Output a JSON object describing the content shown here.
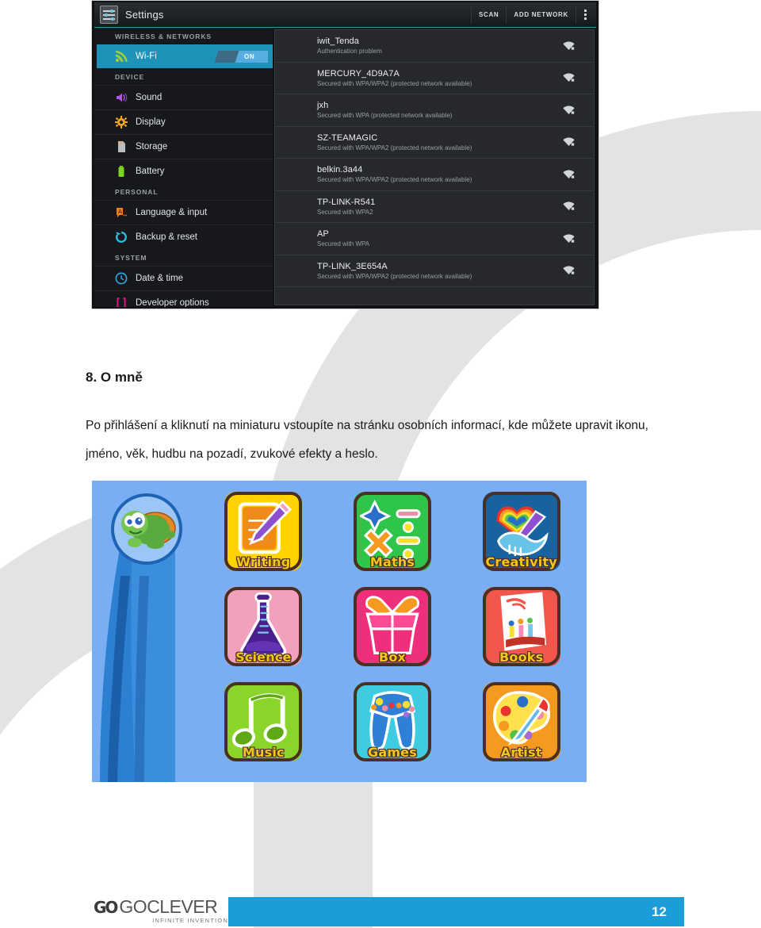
{
  "settings_window": {
    "title": "Settings",
    "app_icon": "settings-sliders-icon",
    "actions": [
      {
        "name": "scan-button",
        "label": "SCAN"
      },
      {
        "name": "add-network-button",
        "label": "ADD NETWORK"
      }
    ],
    "overflow_label": "more-options",
    "sidebar": {
      "groups": [
        {
          "header": "WIRELESS & NETWORKS",
          "items": [
            {
              "label": "Wi-Fi",
              "icon": "wifi-signal-icon",
              "selected": true,
              "toggle": "ON",
              "icon_color": "#a4d22b"
            }
          ]
        },
        {
          "header": "DEVICE",
          "items": [
            {
              "label": "Sound",
              "icon": "speaker-icon",
              "selected": false,
              "icon_color": "#b750e8"
            },
            {
              "label": "Display",
              "icon": "brightness-gear-icon",
              "selected": false,
              "icon_color": "#f5a623"
            },
            {
              "label": "Storage",
              "icon": "sd-card-icon",
              "selected": false,
              "icon_color": "#b9bcc0"
            },
            {
              "label": "Battery",
              "icon": "battery-icon",
              "selected": false,
              "icon_color": "#7ed321"
            }
          ]
        },
        {
          "header": "PERSONAL",
          "items": [
            {
              "label": "Language & input",
              "icon": "language-input-icon",
              "selected": false,
              "icon_color": "#f07d17"
            },
            {
              "label": "Backup & reset",
              "icon": "backup-reset-icon",
              "selected": false,
              "icon_color": "#29bde0"
            }
          ]
        },
        {
          "header": "SYSTEM",
          "items": [
            {
              "label": "Date & time",
              "icon": "clock-icon",
              "selected": false,
              "icon_color": "#2fa7dd"
            },
            {
              "label": "Developer options",
              "icon": "braces-icon",
              "selected": false,
              "icon_color": "#e6158c"
            }
          ]
        }
      ]
    },
    "wifi_networks": [
      {
        "ssid": "iwit_Tenda",
        "status": "Authentication problem"
      },
      {
        "ssid": "MERCURY_4D9A7A",
        "status": "Secured with WPA/WPA2 (protected network available)"
      },
      {
        "ssid": "jxh",
        "status": "Secured with WPA (protected network available)"
      },
      {
        "ssid": "SZ-TEAMAGIC",
        "status": "Secured with WPA/WPA2 (protected network available)"
      },
      {
        "ssid": "belkin.3a44",
        "status": "Secured with WPA/WPA2 (protected network available)"
      },
      {
        "ssid": "TP-LINK-R541",
        "status": "Secured with WPA2"
      },
      {
        "ssid": "AP",
        "status": "Secured with WPA"
      },
      {
        "ssid": "TP-LINK_3E654A",
        "status": "Secured with WPA/WPA2 (protected network available)"
      }
    ]
  },
  "document": {
    "heading": "8. O mně",
    "paragraph": "Po přihlášení a kliknutí na miniaturu vstoupíte na stránku osobních informací, kde můžete upravit ikonu, jméno, věk, hudbu na pozadí, zvukové efekty a heslo."
  },
  "launcher": {
    "avatar": "turtle-avatar",
    "background_color": "#79aef3",
    "ribbon_color": "#1f63b4",
    "tiles": [
      {
        "label": "Writing",
        "icon": "pencil-note-icon",
        "color": "#ffd200",
        "glyph_color": "#f08a1a"
      },
      {
        "label": "Maths",
        "icon": "math-symbols-icon",
        "color": "#2fc44a",
        "glyph_color": "#ffffff"
      },
      {
        "label": "Creativity",
        "icon": "rainbow-bird-icon",
        "color": "#17639f",
        "glyph_color": "#67c4e8"
      },
      {
        "label": "Science",
        "icon": "flask-icon",
        "color": "#f2a0bb",
        "glyph_color": "#4b1f8f"
      },
      {
        "label": "Box",
        "icon": "gift-box-icon",
        "color": "#ef2f7b",
        "glyph_color": "#ff8a1f"
      },
      {
        "label": "Books",
        "icon": "book-icon",
        "color": "#f0564c",
        "glyph_color": "#ffffff"
      },
      {
        "label": "Music",
        "icon": "music-note-icon",
        "color": "#8bd42a",
        "glyph_color": "#5da813"
      },
      {
        "label": "Games",
        "icon": "gamepad-icon",
        "color": "#3ecde0",
        "glyph_color": "#2f7fd6"
      },
      {
        "label": "Artist",
        "icon": "palette-brush-icon",
        "color": "#f59a20",
        "glyph_color": "#ffe14d"
      }
    ]
  },
  "footer": {
    "page_number": "12",
    "brand_mark": "GO",
    "brand_name": "GOCLEVER",
    "tagline": "INFINITE INVENTION",
    "bar_color": "#1b9dd9"
  }
}
